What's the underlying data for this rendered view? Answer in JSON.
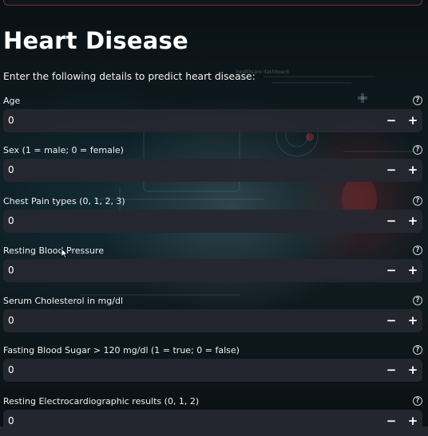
{
  "page": {
    "title": "Heart Disease",
    "subtitle": "Enter the following details to predict heart disease:"
  },
  "fields": [
    {
      "label": "Age",
      "value": "0",
      "minus": "−",
      "plus": "+",
      "help": "?"
    },
    {
      "label": "Sex (1 = male; 0 = female)",
      "value": "0",
      "minus": "−",
      "plus": "+",
      "help": "?"
    },
    {
      "label": "Chest Pain types (0, 1, 2, 3)",
      "value": "0",
      "minus": "−",
      "plus": "+",
      "help": "?"
    },
    {
      "label": "Resting Blood Pressure",
      "value": "0",
      "minus": "−",
      "plus": "+",
      "help": "?"
    },
    {
      "label": "Serum Cholesterol in mg/dl",
      "value": "0",
      "minus": "−",
      "plus": "+",
      "help": "?"
    },
    {
      "label": "Fasting Blood Sugar > 120 mg/dl (1 = true; 0 = false)",
      "value": "0",
      "minus": "−",
      "plus": "+",
      "help": "?"
    },
    {
      "label": "Resting Electrocardiographic results (0, 1, 2)",
      "value": "0",
      "minus": "−",
      "plus": "+",
      "help": "?"
    }
  ],
  "background": {
    "caption": "healthcare dashboard"
  },
  "colors": {
    "input_bg": "#262730",
    "text": "#fafafa",
    "accent_border": "#7a2f3a"
  }
}
